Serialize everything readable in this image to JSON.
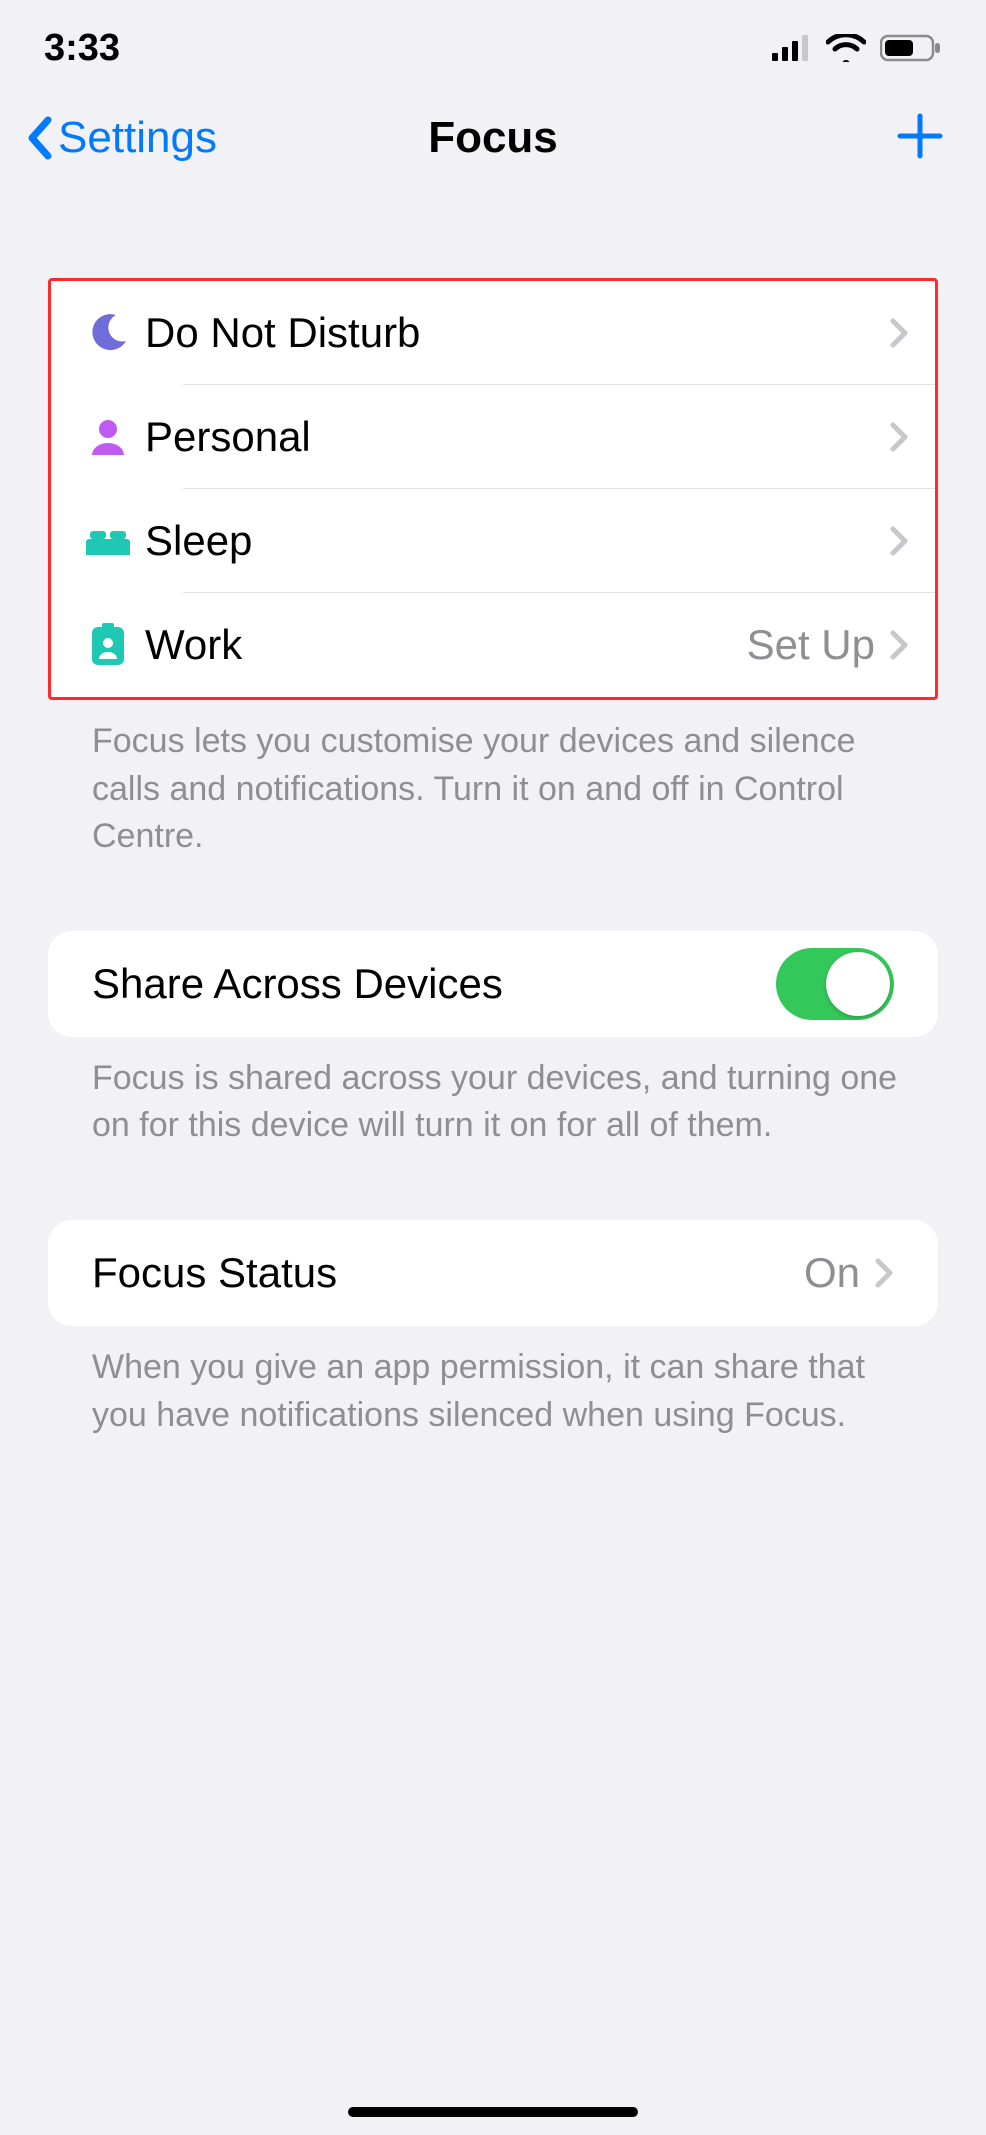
{
  "statusbar": {
    "time": "3:33"
  },
  "nav": {
    "back_label": "Settings",
    "title": "Focus"
  },
  "focus_modes": [
    {
      "id": "dnd",
      "label": "Do Not Disturb",
      "detail": "",
      "icon": "moon",
      "color": "#6f6dd9"
    },
    {
      "id": "personal",
      "label": "Personal",
      "detail": "",
      "icon": "person",
      "color": "#bf5af2"
    },
    {
      "id": "sleep",
      "label": "Sleep",
      "detail": "",
      "icon": "bed",
      "color": "#1fc8b5"
    },
    {
      "id": "work",
      "label": "Work",
      "detail": "Set Up",
      "icon": "badge",
      "color": "#1fc8b5"
    }
  ],
  "focus_footer": "Focus lets you customise your devices and silence calls and notifications. Turn it on and off in Control Centre.",
  "share": {
    "label": "Share Across Devices",
    "on": true,
    "footer": "Focus is shared across your devices, and turning one on for this device will turn it on for all of them."
  },
  "focus_status": {
    "label": "Focus Status",
    "value": "On",
    "footer": "When you give an app permission, it can share that you have notifications silenced when using Focus."
  }
}
